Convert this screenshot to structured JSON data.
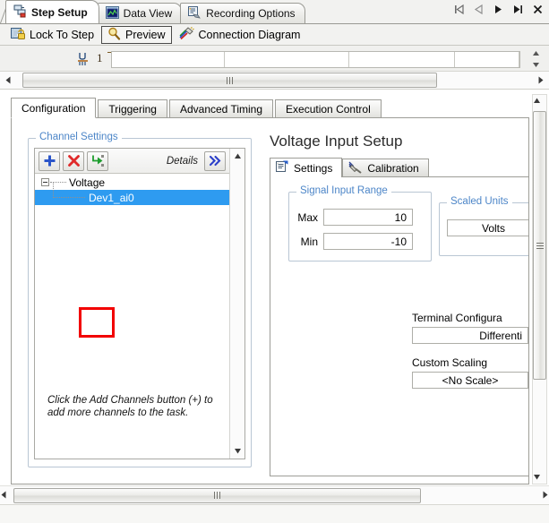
{
  "window": {
    "top_tabs": [
      {
        "label": "Step Setup",
        "icon": "step-setup-icon",
        "active": true
      },
      {
        "label": "Data View",
        "icon": "data-view-icon",
        "active": false
      },
      {
        "label": "Recording Options",
        "icon": "recording-options-icon",
        "active": false
      }
    ],
    "nav_buttons": [
      {
        "name": "first-step-button",
        "glyph": "first"
      },
      {
        "name": "previous-step-button",
        "glyph": "previous"
      },
      {
        "name": "next-step-button",
        "glyph": "next"
      },
      {
        "name": "last-step-button",
        "glyph": "last"
      },
      {
        "name": "close-button",
        "glyph": "close"
      }
    ]
  },
  "toolbar": {
    "items": [
      {
        "label": "Lock To Step",
        "icon": "lock-icon",
        "framed": false
      },
      {
        "label": "Preview",
        "icon": "magnifier-icon",
        "framed": true
      },
      {
        "label": "Connection Diagram",
        "icon": "connection-diagram-icon",
        "framed": false
      }
    ]
  },
  "strip": {
    "index_label": "1",
    "glyph": "numeric-control-icon"
  },
  "page_tabs": [
    {
      "label": "Configuration",
      "active": true
    },
    {
      "label": "Triggering",
      "active": false
    },
    {
      "label": "Advanced Timing",
      "active": false
    },
    {
      "label": "Execution Control",
      "active": false
    }
  ],
  "channel_settings": {
    "group_label": "Channel Settings",
    "buttons": [
      {
        "name": "add-channel-button",
        "icon": "plus-icon",
        "tooltip_label": "+"
      },
      {
        "name": "remove-channel-button",
        "icon": "x-icon",
        "tooltip_label": "X"
      },
      {
        "name": "change-physical-channel-button",
        "icon": "green-arrow-icon",
        "highlighted": true
      }
    ],
    "details_label": "Details",
    "expand_button": {
      "name": "expand-details-button",
      "icon": "double-chevron-right-icon"
    },
    "tree": {
      "root": {
        "label": "Voltage",
        "expanded": true
      },
      "child": {
        "label": "Dev1_ai0",
        "selected": true
      }
    },
    "hint_text": "Click the Add Channels button (+) to add more channels to the task."
  },
  "voltage_input_setup": {
    "title": "Voltage Input Setup",
    "tabs": [
      {
        "label": "Settings",
        "icon": "settings-icon",
        "active": true
      },
      {
        "label": "Calibration",
        "icon": "calibration-icon",
        "active": false
      }
    ],
    "signal_input_range": {
      "group_label": "Signal Input Range",
      "max_label": "Max",
      "max_value": "10",
      "min_label": "Min",
      "min_value": "-10"
    },
    "scaled_units": {
      "group_label": "Scaled Units",
      "value": "Volts"
    },
    "terminal_configuration": {
      "label": "Terminal Configura",
      "value": "Differenti"
    },
    "custom_scaling": {
      "label": "Custom Scaling",
      "value": "<No Scale>"
    }
  },
  "colors": {
    "accent_blue": "#2e9bf0",
    "group_label_blue": "#4d86c8",
    "highlight_red": "#f20000",
    "add_plus": "#2b55c9",
    "remove_x": "#e02a2a",
    "green_arrow": "#1e9e2e",
    "chevron_blue": "#2b3fc9"
  }
}
